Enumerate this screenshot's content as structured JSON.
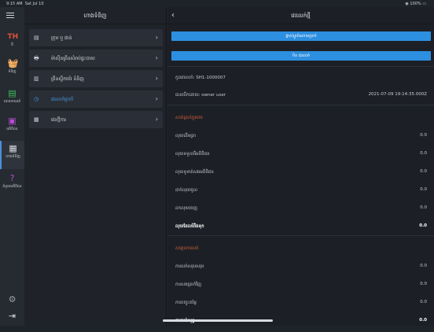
{
  "status_bar": {
    "time": "9:15 AM",
    "date": "Sat Jul 10",
    "battery": "100%"
  },
  "sidebar": {
    "items": [
      {
        "label": "ពី",
        "icon": "th-icon"
      },
      {
        "label": "ទំនិញ",
        "icon": "basket-icon"
      },
      {
        "label": "របាយការណ៍",
        "icon": "report-icon"
      },
      {
        "label": "អតិថិជន",
        "icon": "customer-icon"
      },
      {
        "label": "ហាងទំនិញ",
        "icon": "store-icon"
      },
      {
        "label": "ជំនួយអតិថិជន",
        "icon": "help-icon"
      }
    ]
  },
  "menu_column": {
    "title": "ហាងទំនិញ",
    "items": [
      {
        "label": "ក្រុម ឬ ផាន់",
        "icon": "grid-icon"
      },
      {
        "label": "ម៉ាស៊ីនព្រីនសំរាប់ផ្ទះបាយ",
        "icon": "printer-icon"
      },
      {
        "label": "ព្រីនស្ទីកឃ័រ ទំនិញ",
        "icon": "barcode-icon"
      },
      {
        "label": "វេនលក់ប្រចាំ",
        "icon": "clock-icon"
      },
      {
        "label": "វេនថ្មីការ",
        "icon": "calendar-icon"
      }
    ]
  },
  "detail": {
    "title": "វេនលក់ថ្មី",
    "btn_primary": "ផ្លាស់ប្តូរចំណាយប្រាក់",
    "btn_secondary": "បិទ វេនលក់",
    "shift_code_label": "កូដវេនលក់: SH1-1000007",
    "opened_by_label": "បានបើកដោយ: owner user",
    "opened_at": "2021-07-09 19:14:35.000Z",
    "cash_section": "សាច់ប្រាក់ក្នុងថត",
    "cash_rows": [
      {
        "label": "លុយដើមគ្រា",
        "value": "0.0"
      },
      {
        "label": "លុយទទួលពីអតិថិជន",
        "value": "0.0"
      },
      {
        "label": "លុយទូទាត់សងអតិថិជន",
        "value": "0.0"
      },
      {
        "label": "ដាក់លុយចូល",
        "value": "0.0"
      },
      {
        "label": "ដកលុយចេញ",
        "value": "0.0"
      }
    ],
    "expected_label": "លុយដែលរំពឹងទុក",
    "expected_value": "0.0",
    "sales_section": "សង្ខេបការលក់",
    "sales_rows": [
      {
        "label": "ការលក់សរុបសរុប",
        "value": "0.0"
      },
      {
        "label": "ការសងប្រាក់វិញ",
        "value": "0.0"
      },
      {
        "label": "ការបញ្ចុះតម្លៃ",
        "value": "0.0"
      }
    ],
    "net_label": "ការលក់សុទ្ធ",
    "net_value": "0.0"
  }
}
